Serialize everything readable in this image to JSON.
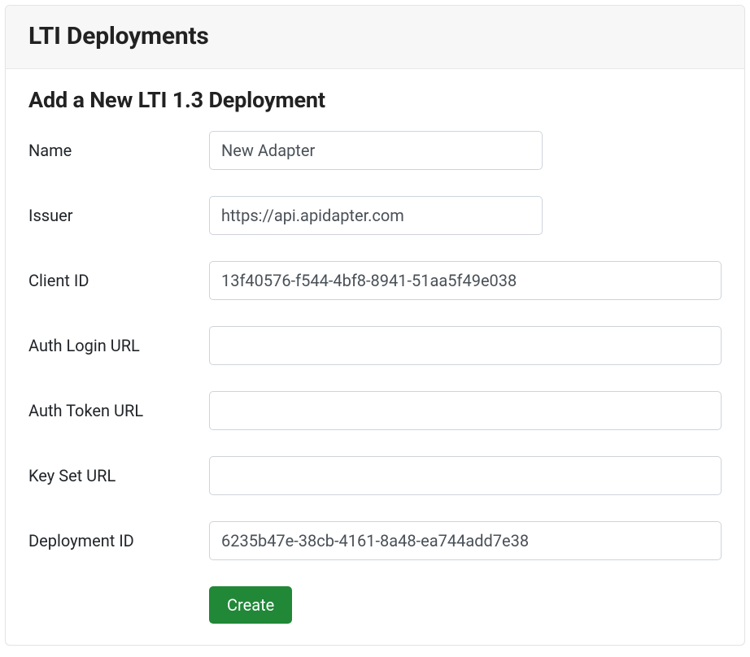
{
  "header": {
    "title": "LTI Deployments"
  },
  "form": {
    "heading": "Add a New LTI 1.3 Deployment",
    "fields": {
      "name": {
        "label": "Name",
        "value": "New Adapter"
      },
      "issuer": {
        "label": "Issuer",
        "value": "https://api.apidapter.com"
      },
      "client_id": {
        "label": "Client ID",
        "value": "13f40576-f544-4bf8-8941-51aa5f49e038"
      },
      "auth_login_url": {
        "label": "Auth Login URL",
        "value": ""
      },
      "auth_token_url": {
        "label": "Auth Token URL",
        "value": ""
      },
      "key_set_url": {
        "label": "Key Set URL",
        "value": ""
      },
      "deployment_id": {
        "label": "Deployment ID",
        "value": "6235b47e-38cb-4161-8a48-ea744add7e38"
      }
    },
    "submit_label": "Create"
  },
  "colors": {
    "button_primary": "#218838"
  }
}
